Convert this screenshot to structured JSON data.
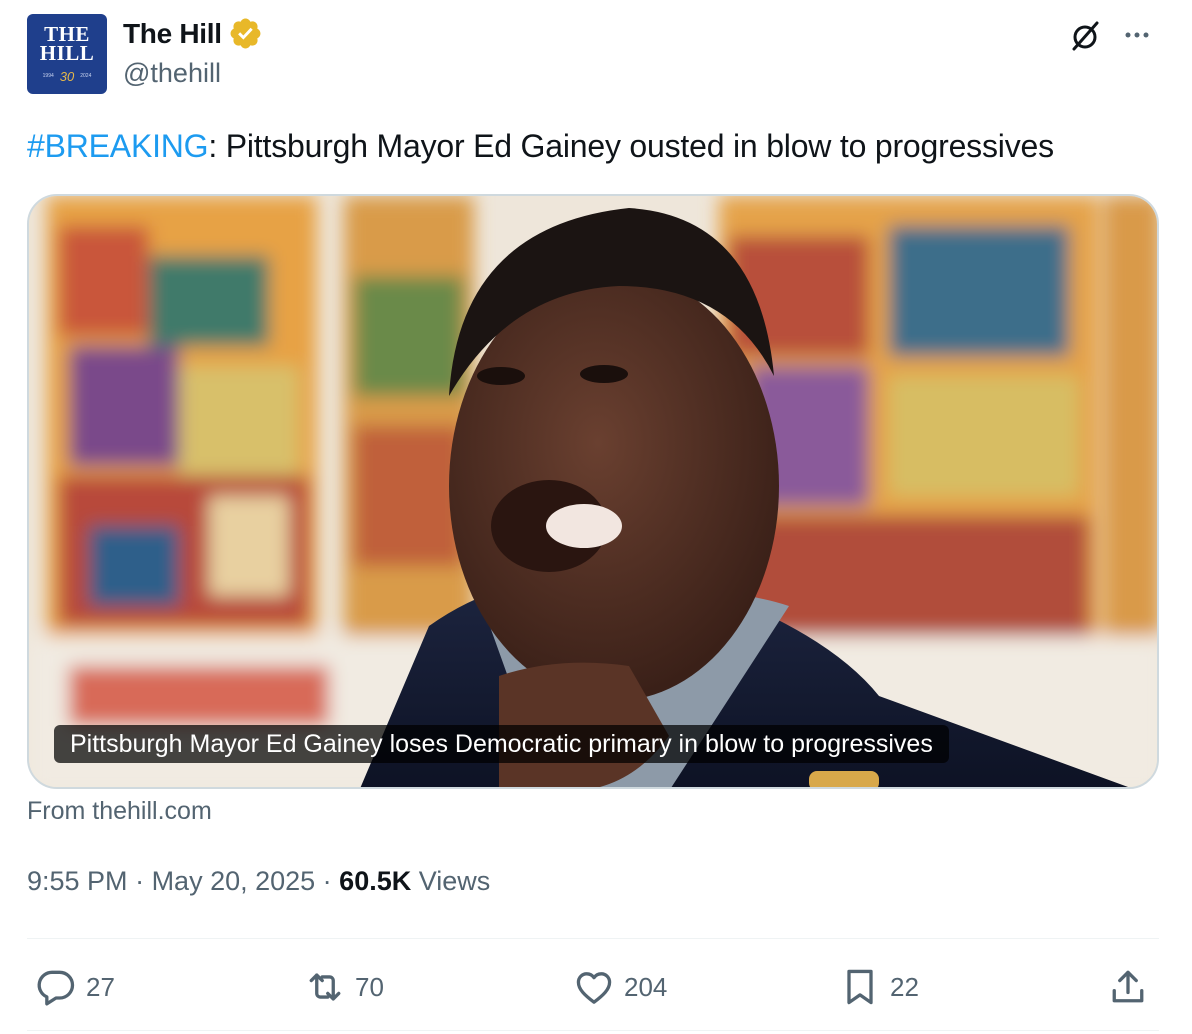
{
  "account": {
    "avatar_line1": "THE",
    "avatar_line2": "HILL",
    "avatar_year_start": "1994",
    "avatar_anniversary": "30",
    "avatar_year_end": "2024",
    "display_name": "The Hill",
    "handle": "@thehill",
    "verified_badge_color": "#e8b829"
  },
  "tweet": {
    "hashtag": "#BREAKING",
    "text": ": Pittsburgh Mayor Ed Gainey ousted in blow to progressives"
  },
  "card": {
    "caption": "Pittsburgh Mayor Ed Gainey loses Democratic primary in blow to progressives",
    "source": "From thehill.com"
  },
  "meta": {
    "time": "9:55 PM",
    "separator": " · ",
    "date": "May 20, 2025",
    "views_count": "60.5K",
    "views_label": "Views"
  },
  "actions": {
    "replies": "27",
    "reposts": "70",
    "likes": "204",
    "bookmarks": "22"
  },
  "icons": [
    "grok-icon",
    "more-icon",
    "verified-badge-icon",
    "reply-icon",
    "repost-icon",
    "like-icon",
    "bookmark-icon",
    "share-icon"
  ],
  "colors": {
    "link": "#1d9bf0",
    "secondary_text": "#536471",
    "primary_text": "#0f1419",
    "border": "#cfd9de"
  }
}
